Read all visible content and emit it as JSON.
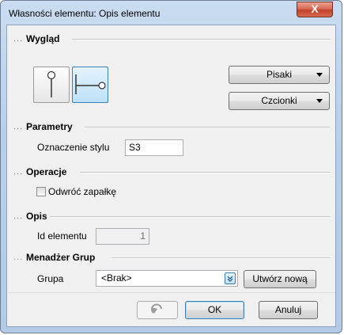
{
  "window": {
    "title": "Własności elementu: Opis elementu",
    "close_glyph": "X"
  },
  "sections": {
    "wyglad": "Wygląd",
    "parametry": "Parametry",
    "operacje": "Operacje",
    "opis": "Opis",
    "menadzer": "Menadżer Grup"
  },
  "section_dots": "...",
  "appearance": {
    "pisaki_label": "Pisaki",
    "czcionki_label": "Czcionki",
    "style_options": [
      {
        "icon": "vertical-pin-icon",
        "selected": false
      },
      {
        "icon": "horizontal-pin-icon",
        "selected": true
      }
    ]
  },
  "parametry": {
    "style_label": "Oznaczenie stylu",
    "style_value": "S3"
  },
  "operacje": {
    "reverse_label": "Odwróć zapałkę",
    "reverse_checked": false
  },
  "opis": {
    "id_label": "Id elementu",
    "id_value": "1"
  },
  "groups": {
    "group_label": "Grupa",
    "group_value": "<Brak>",
    "create_label": "Utwórz nową"
  },
  "footer": {
    "ok_label": "OK",
    "cancel_label": "Anuluj",
    "undo_icon": "undo-icon"
  },
  "colors": {
    "accent": "#3c7fb1",
    "selected_bg": "#cfe8fa",
    "close_red": "#c2412a"
  }
}
